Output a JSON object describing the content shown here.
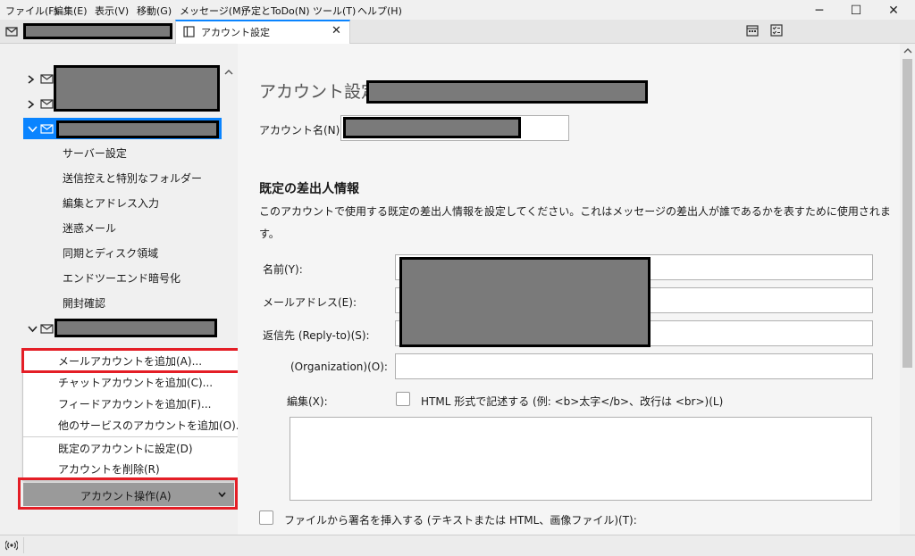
{
  "menubar": {
    "items": [
      "ファイル(F)",
      "編集(E)",
      "表示(V)",
      "移動(G)",
      "メッセージ(M)",
      "予定とToDo(N)",
      "ツール(T)",
      "ヘルプ(H)"
    ]
  },
  "window_controls": {
    "minimize": "─",
    "maximize": "☐",
    "close": "✕"
  },
  "tabs": {
    "active_label": "アカウント設定",
    "close_glyph": "✕"
  },
  "sidebar": {
    "sub_items": [
      "サーバー設定",
      "送信控えと特別なフォルダー",
      "編集とアドレス入力",
      "迷惑メール",
      "同期とディスク領域",
      "エンドツーエンド暗号化",
      "開封確認"
    ]
  },
  "account_menu": {
    "items": [
      "メールアカウントを追加(A)...",
      "チャットアカウントを追加(C)...",
      "フィードアカウントを追加(F)...",
      "他のサービスのアカウントを追加(O)...",
      "既定のアカウントに設定(D)",
      "アカウントを削除(R)"
    ],
    "button_label": "アカウント操作(A)"
  },
  "settings": {
    "page_title": "アカウント設定",
    "account_name_label": "アカウント名(N):",
    "section_title": "既定の差出人情報",
    "section_desc_line1": "このアカウントで使用する既定の差出人情報を設定してください。これはメッセージの差出人が誰であるかを表すために使用されま",
    "section_desc_line2": "す。",
    "name_label": "名前(Y):",
    "email_label": "メールアドレス(E):",
    "replyto_label": "返信先 (Reply-to)(S):",
    "org_label": "(Organization)(O):",
    "edit_label": "編集(X):",
    "html_checkbox_label": "HTML 形式で記述する (例: <b>太字</b>、改行は <br>)(L)",
    "signature_file_label": "ファイルから署名を挿入する (テキストまたは HTML、画像ファイル)(T):"
  },
  "colors": {
    "accent": "#0a84ff",
    "highlight": "#e41e26",
    "redaction": "#7a7a7a"
  }
}
